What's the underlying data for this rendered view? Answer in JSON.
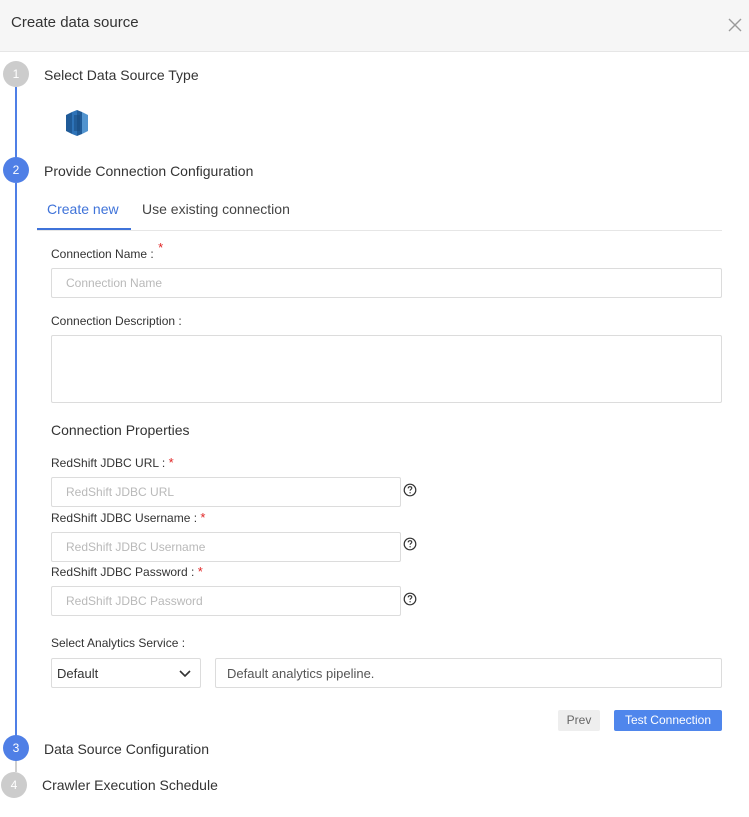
{
  "dialog": {
    "title": "Create data source",
    "close_icon": "close-icon"
  },
  "steps": [
    {
      "number": "1",
      "title": "Select Data Source Type",
      "state": "completed"
    },
    {
      "number": "2",
      "title": "Provide Connection Configuration",
      "state": "active"
    },
    {
      "number": "3",
      "title": "Data Source Configuration",
      "state": "active"
    },
    {
      "number": "4",
      "title": "Crawler Execution Schedule",
      "state": "inactive"
    }
  ],
  "data_source_icon": "amazon-redshift-icon",
  "tabs": [
    {
      "label": "Create new",
      "active": true
    },
    {
      "label": "Use existing connection",
      "active": false
    }
  ],
  "form": {
    "connection_name": {
      "label": "Connection Name :",
      "placeholder": "Connection Name",
      "required": "*",
      "value": ""
    },
    "connection_description": {
      "label": "Connection Description :",
      "value": ""
    },
    "connection_properties_title": "Connection Properties",
    "jdbc_url": {
      "label": "RedShift JDBC URL :",
      "required": "*",
      "placeholder": "RedShift JDBC URL",
      "value": ""
    },
    "jdbc_username": {
      "label": "RedShift JDBC Username :",
      "required": "*",
      "placeholder": "RedShift JDBC Username",
      "value": ""
    },
    "jdbc_password": {
      "label": "RedShift JDBC Password :",
      "required": "*",
      "placeholder": "RedShift JDBC Password",
      "value": ""
    },
    "analytics_service": {
      "label": "Select Analytics Service :",
      "selected": "Default",
      "description": "Default analytics pipeline."
    }
  },
  "buttons": {
    "prev": "Prev",
    "test_connection": "Test Connection"
  },
  "colors": {
    "accent": "#4f7fe6",
    "required": "#e02424",
    "inactive_step": "#cccccc"
  }
}
